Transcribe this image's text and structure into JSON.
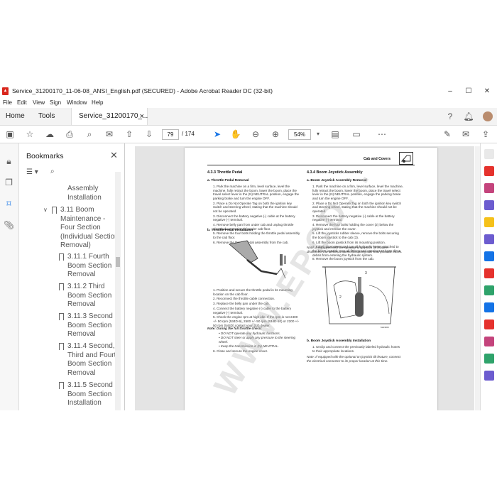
{
  "window": {
    "title": "Service_31200170_11-06-08_ANSI_English.pdf (SECURED) - Adobe Acrobat Reader DC (32-bit)",
    "minimize": "–",
    "maximize": "☐",
    "close": "✕"
  },
  "menu": [
    "File",
    "Edit",
    "View",
    "Sign",
    "Window",
    "Help"
  ],
  "tabs": {
    "home": "Home",
    "tools": "Tools",
    "document": "Service_31200170_...",
    "close": "×"
  },
  "toolbar": {
    "page_current": "79",
    "page_total": "/ 174",
    "zoom": "54%"
  },
  "bookmarks": {
    "title": "Bookmarks",
    "items": [
      {
        "lines": [
          "Assembly",
          "Installation"
        ]
      },
      {
        "lines": [
          "3.11 Boom",
          "Maintenance -",
          "Four Section",
          "(Individual Section",
          "Removal)"
        ]
      },
      {
        "lines": [
          "3.11.1 Fourth",
          "Boom Section",
          "Removal"
        ]
      },
      {
        "lines": [
          "3.11.2 Third",
          "Boom Section",
          "Removal"
        ]
      },
      {
        "lines": [
          "3.11.3 Second",
          "Boom Section",
          "Removal"
        ]
      },
      {
        "lines": [
          "3.11.4 Second,",
          "Third and Fourth",
          "Boom Section",
          "Removal"
        ]
      },
      {
        "lines": [
          "3.11.5 Second",
          "Boom Section",
          "Installation"
        ]
      }
    ]
  },
  "doc": {
    "header": "Cab and Covers",
    "left": {
      "section": "4.3.3        Throttle Pedal",
      "sub_a": "a.    Throttle Pedal Removal",
      "steps_a": [
        "1.  Park the machine on a firm, level surface, level the machine, fully retract the boom, lower the boom, place the travel select lever in the (N) NEUTRAL position, engage the parking brake and turn the engine OFF.",
        "2.  Place a Do Not Operate Tag on both the ignition key switch and steering wheel, stating that the machine should not be operated.",
        "3.  Disconnect the battery negative (-) cable at the battery negative (-) terminal.",
        "4.  Remove belly pan from under cab and unplug throttle electrical connection (1) under cab floor.",
        "5.  Remove the four bolts holding the throttle pedal assembly to the cab floor.",
        "6.  Remove the throttle pedal assembly from the cab."
      ],
      "sub_b": "b.    Throttle Pedal Installation",
      "steps_b": [
        "1.  Position and secure the throttle pedal in its mounting location on the cab floor.",
        "2.  Reconnect the throttle cable connection.",
        "3.  Replace the belly pan under the cab.",
        "4.  Connect the battery negative (-) cable to the battery negative (-) terminal.",
        "5.  Check the engine rpm at high idle. If the rpm is not 2400 +/- 50 rpm (534D-9), 2500 +/- 50 rpm (534D-10) or 2200 +/- 50 rpm (544D) contact your JLG dealer."
      ],
      "note": "Note:  During the full throttle check:",
      "bullets": [
        "• DO NOT operate any hydraulic functions.",
        "• DO NOT steer or apply any pressure to the steering wheel.",
        "• Keep the transmission in (N) NEUTRAL."
      ],
      "step6": "6.  Close and secure the engine cover."
    },
    "right": {
      "section": "4.3.4        Boom Joystick Assembly",
      "sub_a": "a.    Boom Joystick Assembly Removal",
      "steps_a": [
        "1.  Park the machine on a firm, level surface, level the machine, fully retract the boom, lower the boom, place the travel select lever in the (N) NEUTRAL position, engage the parking brake and turn the engine OFF.",
        "2.  Place a Do Not Operate Tag on both the ignition key switch and steering wheel, stating that the machine should not be operated.",
        "3.  Disconnect the battery negative (-) cable at the battery negative (-) terminal.",
        "4.  Remove the four bolts holding the cover (2) below the joystick and remove the cover.",
        "5.  Lift the joysticks rubber sleeve, remove the bolts securing the boom joystick to the cab (3).",
        "6.  Lift the boom joystick from its mounting position.",
        "7.  Label, disconnect and cap all hydraulic hoses attached to the boom joystick. Cap all fittings and openings to keep dirt & debris from entering the hydraulic system."
      ],
      "note1": "Note:  If equipped with the optional on joystick tilt feature, disconnect the electrical connector along with the hydraulic hoses.",
      "step8": "8.  Remove the boom joystick from the cab.",
      "sub_b": "b.    Boom Joystick Assembly Installation",
      "step_b1": "1.  Unclip and connect the previously labeled hydraulic hoses to their appropriate locations.",
      "note2": "Note:  If equipped with the optional on joystick tilt feature, connect the electrical connector to its proper location at this time."
    },
    "watermark": "WWW.EPCD..."
  },
  "colors": {
    "tab_bg": "#f3f3f3",
    "doc_bg": "#e4e4e4",
    "accent_blue": "#1473e6",
    "pdf_red": "#d9261c"
  }
}
